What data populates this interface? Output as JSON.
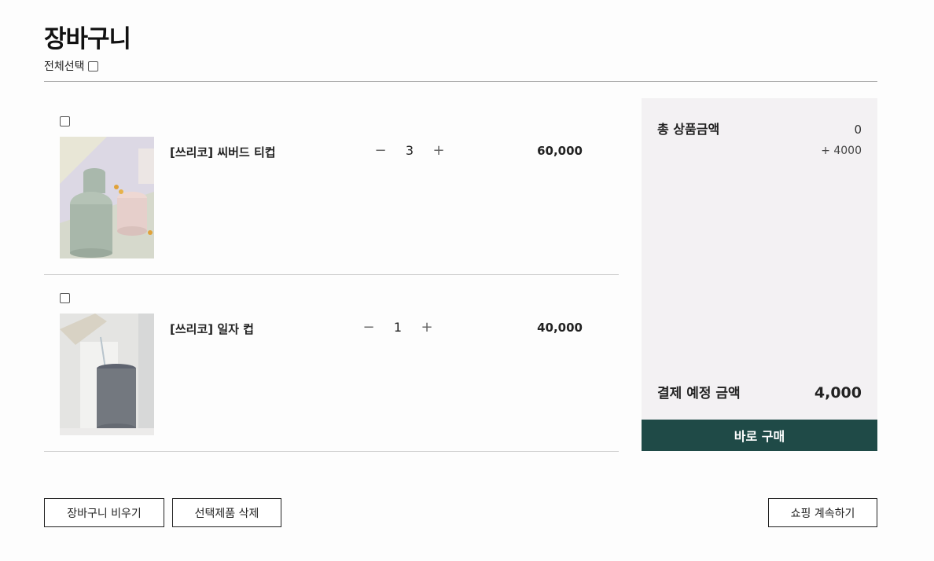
{
  "page": {
    "title": "장바구니",
    "select_all_label": "전체선택"
  },
  "items": [
    {
      "name": "[쓰리코] 씨버드 티컵",
      "quantity": "3",
      "price": "60,000",
      "selected": false
    },
    {
      "name": "[쓰리코] 일자 컵",
      "quantity": "1",
      "price": "40,000",
      "selected": false
    }
  ],
  "icons": {
    "minus": "minus-icon",
    "plus": "plus-icon"
  },
  "summary": {
    "total_label": "총 상품금액",
    "total_value": "0",
    "shipping_value": "+ 4000",
    "final_label": "결제 예정 금액",
    "final_value": "4,000",
    "buy_label": "바로 구매"
  },
  "actions": {
    "clear_cart_label": "장바구니 비우기",
    "delete_selected_label": "선택제품 삭제",
    "continue_shopping_label": "쇼핑 계속하기"
  },
  "colors": {
    "accent": "#1f4a47",
    "summary_bg": "#f3f1f3"
  }
}
